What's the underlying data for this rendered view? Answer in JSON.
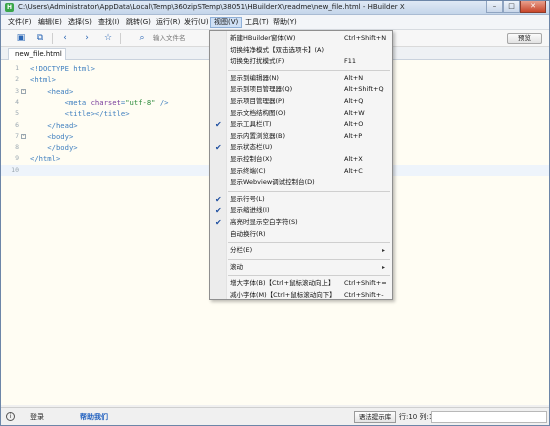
{
  "window": {
    "title": "C:\\Users\\Administrator\\AppData\\Local\\Temp\\360zipSTemp\\38051\\HBuilderX\\readme\\new_file.html - HBuilder X",
    "app_icon": "H",
    "buttons": {
      "minimize": "–",
      "maximize": "□",
      "close": "✕"
    }
  },
  "menubar": {
    "items": [
      "文件(F)",
      "编辑(E)",
      "选择(S)",
      "查找(I)",
      "跳转(G)",
      "运行(R)",
      "发行(U)",
      "视图(V)",
      "工具(T)",
      "帮助(Y)"
    ],
    "active_index": 7
  },
  "toolbar": {
    "icons": [
      "save-icon",
      "copy-icon",
      "back-icon",
      "forward-icon",
      "star-icon",
      "search-icon"
    ],
    "search_placeholder": "输入文件名",
    "preview_label": "预览"
  },
  "tabs": [
    "new_file.html"
  ],
  "editor": {
    "lines": [
      {
        "n": "1",
        "fold": "",
        "parts": [
          {
            "c": "tag",
            "t": "<!DOCTYPE html>"
          }
        ]
      },
      {
        "n": "2",
        "fold": "",
        "parts": [
          {
            "c": "tag",
            "t": "<html>"
          }
        ]
      },
      {
        "n": "3",
        "fold": "⊟",
        "parts": [
          {
            "c": "tag",
            "t": "    <head>"
          }
        ]
      },
      {
        "n": "4",
        "fold": "",
        "parts": [
          {
            "c": "tag",
            "t": "        <meta "
          },
          {
            "c": "att",
            "t": "charset"
          },
          {
            "c": "tag",
            "t": "="
          },
          {
            "c": "str",
            "t": "\"utf-8\""
          },
          {
            "c": "tag",
            "t": " />"
          }
        ]
      },
      {
        "n": "5",
        "fold": "",
        "parts": [
          {
            "c": "tag",
            "t": "        <title></title>"
          }
        ]
      },
      {
        "n": "6",
        "fold": "",
        "parts": [
          {
            "c": "tag",
            "t": "    </head>"
          }
        ]
      },
      {
        "n": "7",
        "fold": "⊟",
        "parts": [
          {
            "c": "tag",
            "t": "    <body>"
          }
        ]
      },
      {
        "n": "8",
        "fold": "",
        "parts": [
          {
            "c": "tag",
            "t": "    </body>"
          }
        ]
      },
      {
        "n": "9",
        "fold": "",
        "parts": [
          {
            "c": "tag",
            "t": "</html>"
          }
        ]
      },
      {
        "n": "10",
        "fold": "",
        "parts": []
      }
    ],
    "current_line": 10
  },
  "view_menu": [
    {
      "label": "新建HBuilder窗体(W)",
      "shortcut": "Ctrl+Shift+N"
    },
    {
      "label": "切换纯净模式【双击选项卡】(A)"
    },
    {
      "label": "切换免打扰模式(F)",
      "shortcut": "F11"
    },
    {
      "sep": true
    },
    {
      "label": "显示到编辑器(N)",
      "shortcut": "Alt+N"
    },
    {
      "label": "显示到项目管理器(Q)",
      "shortcut": "Alt+Shift+Q"
    },
    {
      "label": "显示项目管理器(P)",
      "shortcut": "Alt+Q"
    },
    {
      "label": "显示文档结构图(O)",
      "shortcut": "Alt+W"
    },
    {
      "label": "显示工具栏(T)",
      "shortcut": "Alt+O",
      "checked": true
    },
    {
      "label": "显示内置浏览器(B)",
      "shortcut": "Alt+P"
    },
    {
      "label": "显示状态栏(U)",
      "checked": true
    },
    {
      "label": "显示控制台(X)",
      "shortcut": "Alt+X"
    },
    {
      "label": "显示终端(C)",
      "shortcut": "Alt+C"
    },
    {
      "label": "显示Webview调试控制台(D)"
    },
    {
      "sep": true
    },
    {
      "label": "显示行号(L)",
      "checked": true
    },
    {
      "label": "显示缩进线(I)",
      "checked": true
    },
    {
      "label": "高亮时显示空白字符(S)",
      "checked": true
    },
    {
      "label": "自动换行(R)"
    },
    {
      "sep": true
    },
    {
      "label": "分栏(E)",
      "submenu": true
    },
    {
      "sep": true
    },
    {
      "label": "滚动",
      "submenu": true
    },
    {
      "sep": true
    },
    {
      "label": "增大字体(B)【Ctrl+鼠标滚动向上】",
      "shortcut": "Ctrl+Shift+="
    },
    {
      "label": "减小字体(M)【Ctrl+鼠标滚动向下】",
      "shortcut": "Ctrl+Shift+-"
    }
  ],
  "statusbar": {
    "icon": "i",
    "login": "登录",
    "help": "帮助我们",
    "find_button": "语法提示库",
    "position": "行:10 列:1"
  }
}
